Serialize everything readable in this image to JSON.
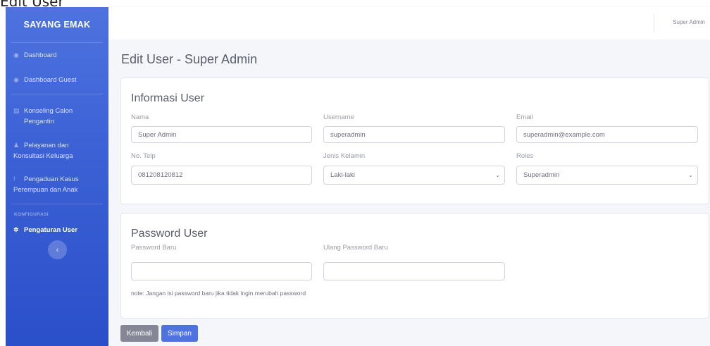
{
  "document": {
    "caption": "Edit User"
  },
  "sidebar": {
    "brand": "SAYANG EMAK",
    "items": [
      {
        "label": "Dashboard",
        "icon": "dashboard-icon"
      },
      {
        "label": "Dashboard Guest",
        "icon": "dashboard-icon"
      },
      {
        "label": "Konseling Calon Pengantin",
        "icon": "book-icon"
      },
      {
        "label": "Pelayanan dan Konsultasi Keluarga",
        "icon": "users-icon"
      },
      {
        "label": "Pengaduan Kasus Perempuan dan Anak",
        "icon": "alert-icon"
      }
    ],
    "section_heading": "KONFIGURASI",
    "config_items": [
      {
        "label": "Pengaturan User",
        "icon": "cogs-icon",
        "active": true
      }
    ],
    "toggle_glyph": "‹"
  },
  "topbar": {
    "user_name": "Super Admin"
  },
  "main": {
    "title": "Edit User - Super Admin",
    "info_card": {
      "title": "Informasi User",
      "nama": {
        "label": "Nama",
        "value": "Super Admin"
      },
      "username": {
        "label": "Username",
        "value": "superadmin"
      },
      "email": {
        "label": "Email",
        "value": "superadmin@example.com"
      },
      "telp": {
        "label": "No. Telp",
        "value": "081208120812"
      },
      "gender": {
        "label": "Jenis Kelamin",
        "value": "Laki-laki"
      },
      "roles": {
        "label": "Roles",
        "value": "Superadmin"
      }
    },
    "password_card": {
      "title": "Password User",
      "new_password": {
        "label": "Password Baru",
        "value": ""
      },
      "repeat_password": {
        "label": "Ulang Password Baru",
        "value": ""
      },
      "note": "note: Jangan isi password baru jika tidak ingin merubah password"
    },
    "buttons": {
      "back": "Kembali",
      "save": "Simpan"
    }
  },
  "colors": {
    "primary": "#4e73df",
    "secondary": "#858796",
    "background": "#f5f6f9"
  }
}
